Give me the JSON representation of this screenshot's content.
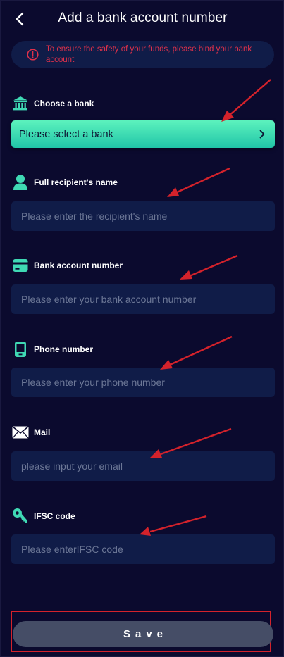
{
  "header": {
    "title": "Add a bank account number"
  },
  "notice": {
    "text": "To ensure the safety of your funds, please bind your bank account"
  },
  "bank": {
    "label": "Choose a bank",
    "select_text": "Please select a bank"
  },
  "name": {
    "label": "Full recipient's name",
    "placeholder": "Please enter the recipient's name"
  },
  "account": {
    "label": "Bank account number",
    "placeholder": "Please enter your bank account number"
  },
  "phone": {
    "label": "Phone number",
    "placeholder": "Please enter your phone number"
  },
  "mail": {
    "label": "Mail",
    "placeholder": "please input your email"
  },
  "ifsc": {
    "label": "IFSC code",
    "placeholder": "Please enterIFSC code"
  },
  "save": {
    "label": "Save"
  },
  "colors": {
    "background": "#0b0a2e",
    "field": "#101c48",
    "accent": "#3fd9b4",
    "warning": "#e0314b",
    "annotation": "#d4222b"
  },
  "icons": [
    "back-chevron-icon",
    "warning-circle-icon",
    "bank-icon",
    "person-icon",
    "card-icon",
    "phone-icon",
    "mail-icon",
    "key-icon",
    "chevron-right-icon"
  ]
}
